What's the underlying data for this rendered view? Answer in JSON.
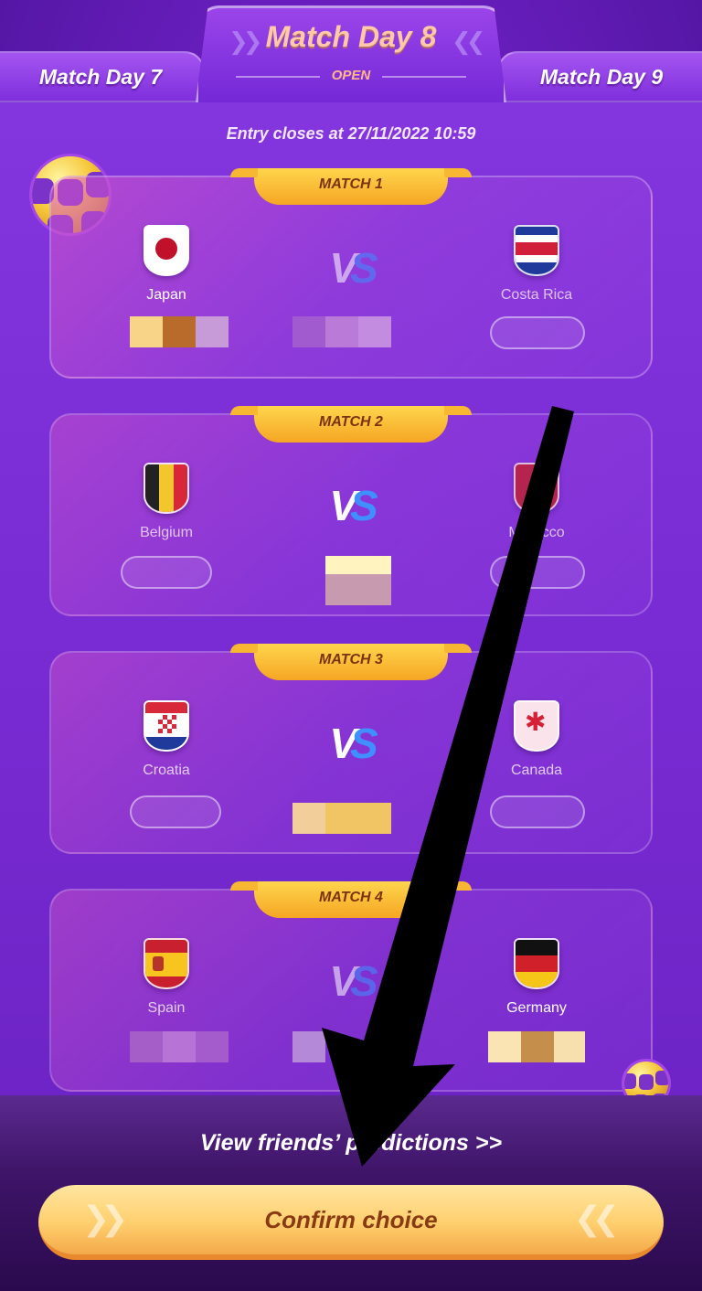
{
  "header": {
    "prev_tab": "Match Day 7",
    "current_tab": "Match Day 8",
    "current_status": "OPEN",
    "next_tab": "Match Day 9"
  },
  "entry_closes": "Entry closes at 27/11/2022 10:59",
  "matches": [
    {
      "label": "MATCH 1",
      "home": "Japan",
      "away": "Costa Rica",
      "home_flag": "japan-flag-icon",
      "away_flag": "costa-rica-flag-icon"
    },
    {
      "label": "MATCH 2",
      "home": "Belgium",
      "away": "Morocco",
      "home_flag": "belgium-flag-icon",
      "away_flag": "morocco-flag-icon"
    },
    {
      "label": "MATCH 3",
      "home": "Croatia",
      "away": "Canada",
      "home_flag": "croatia-flag-icon",
      "away_flag": "canada-flag-icon"
    },
    {
      "label": "MATCH 4",
      "home": "Spain",
      "away": "Germany",
      "home_flag": "spain-flag-icon",
      "away_flag": "germany-flag-icon"
    }
  ],
  "vs_text": {
    "v": "V",
    "s": "S"
  },
  "footer": {
    "view_friends": "View friends’ predictions >>",
    "confirm": "Confirm choice"
  },
  "colors": {
    "accent_gold": "#f5a623",
    "panel_purple": "#7a2cd4",
    "confirm_text": "#8a3a12"
  }
}
